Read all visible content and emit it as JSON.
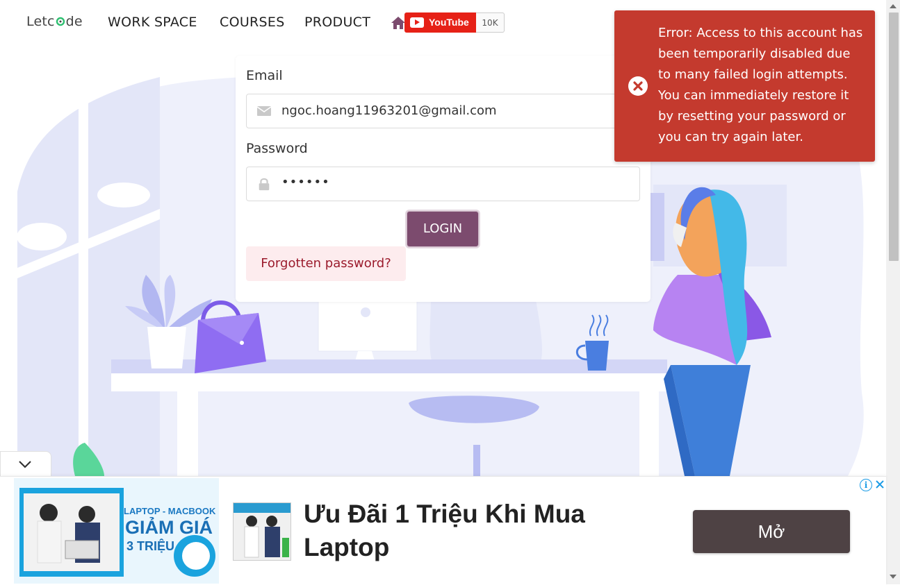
{
  "nav": {
    "logo_text_before": "Letc",
    "logo_text_after": "de",
    "links": [
      "WORK SPACE",
      "COURSES",
      "PRODUCT"
    ],
    "youtube_label": "YouTube",
    "youtube_count": "10K"
  },
  "login": {
    "email_label": "Email",
    "email_value": "ngoc.hoang11963201@gmail.com",
    "password_label": "Password",
    "password_value": "••••••",
    "login_button": "LOGIN",
    "forgot_button": "Forgotten password?"
  },
  "toast": {
    "message": "Error: Access to this account has been temporarily disabled due to many failed login attempts. You can immediately restore it by resetting your password or you can try again later.",
    "color": "#c43a2e"
  },
  "ad": {
    "image_text_1": "LAPTOP - MACBOOK",
    "image_text_2": "GIẢM GIÁ",
    "image_text_3": "3 TRIỆU",
    "headline": "Ưu Đãi 1 Triệu Khi Mua Laptop",
    "cta": "Mở",
    "info_glyph": "i"
  },
  "colors": {
    "accent": "#7c4b6e",
    "forgot_bg": "#fdecee",
    "forgot_text": "#9b1b2c",
    "youtube": "#e62117",
    "logo_green": "#2fbf71"
  }
}
